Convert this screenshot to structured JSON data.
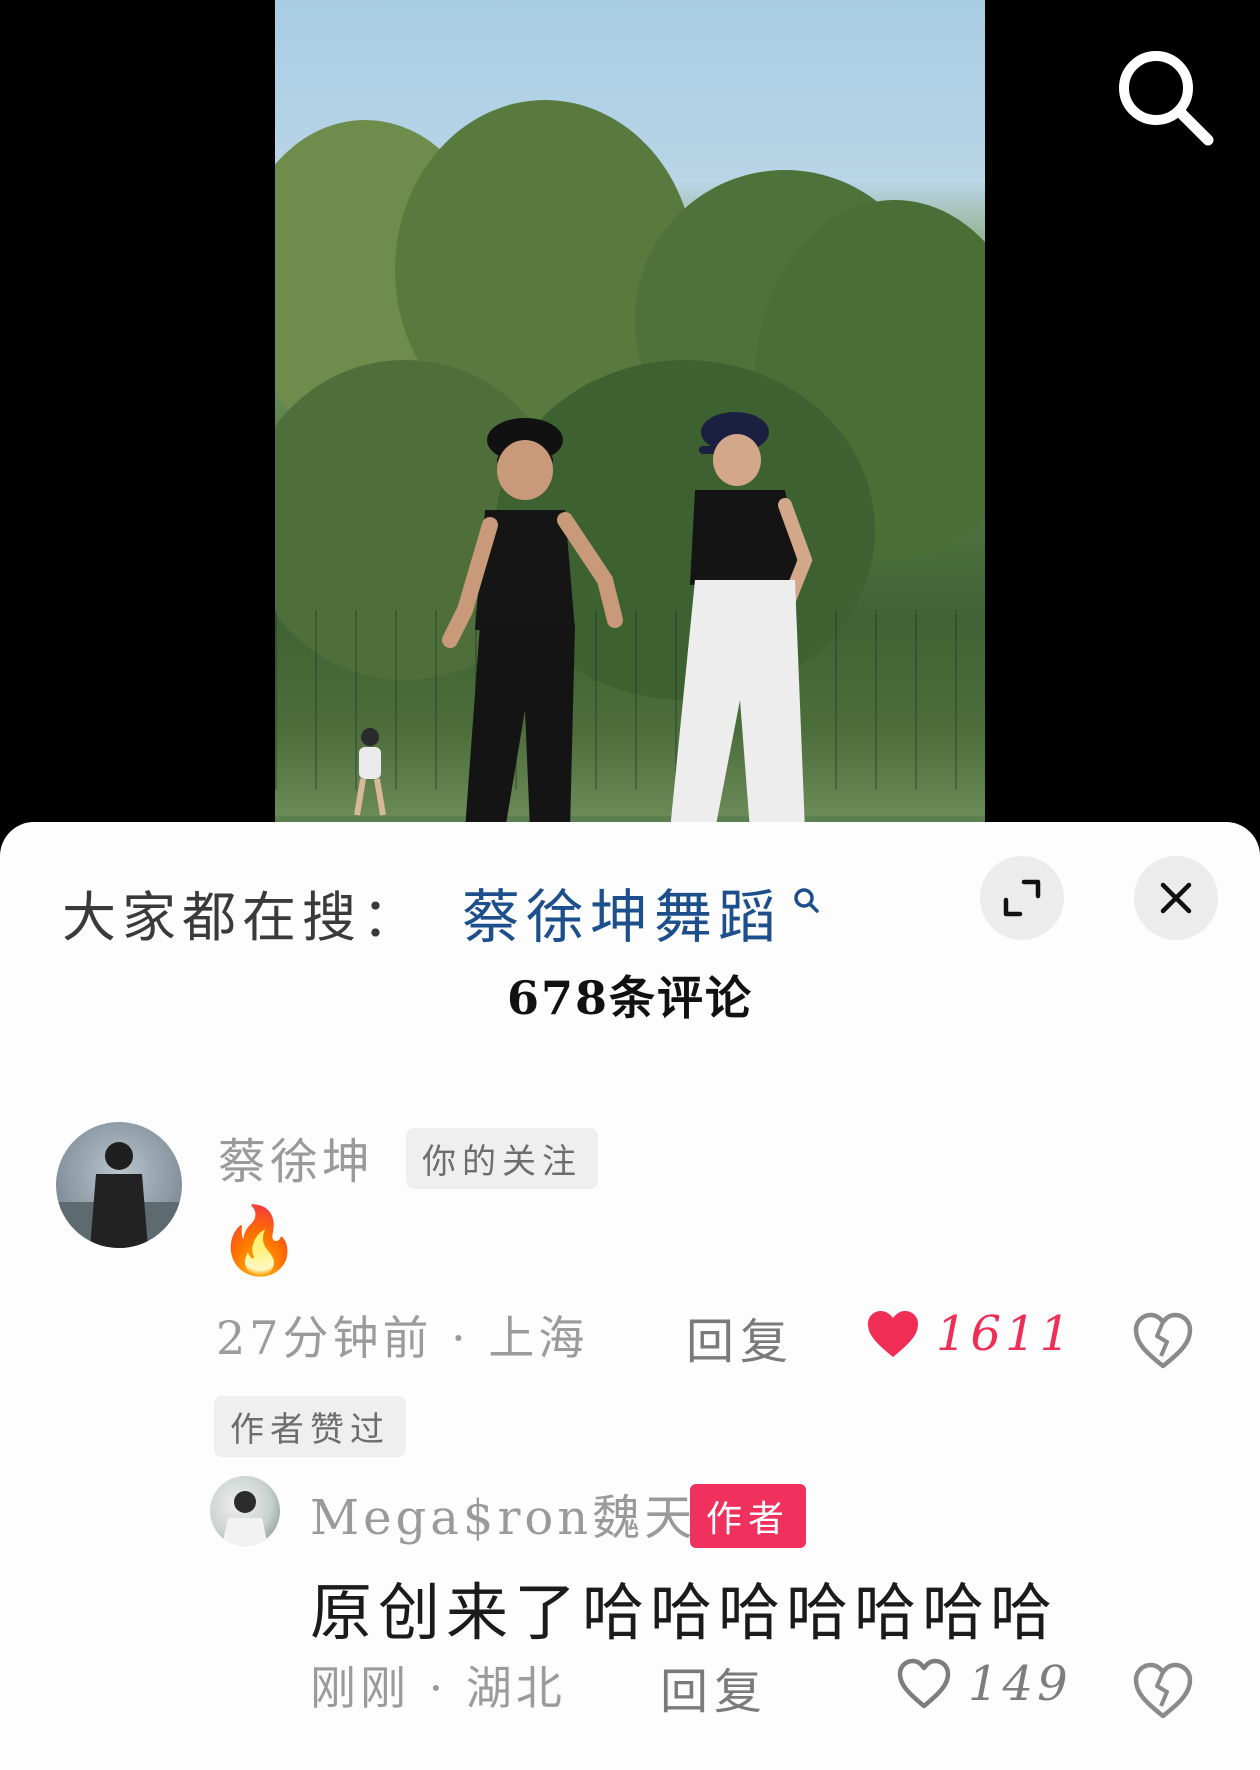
{
  "video": {
    "search_icon": "search-icon"
  },
  "sheet": {
    "hot_search_label": "大家都在搜：",
    "hot_search_term": "蔡徐坤舞蹈",
    "comment_count_label": "678条评论",
    "expand_icon": "expand-icon",
    "close_icon": "close-icon"
  },
  "comments": [
    {
      "username": "蔡徐坤",
      "badge": "你的关注",
      "text": "🔥",
      "meta": "27分钟前 · 上海",
      "reply_label": "回复",
      "like_count": "1611",
      "liked": true,
      "author_liked_tag": "作者赞过"
    },
    {
      "username": "Mega$ron魏天",
      "badge": "作者",
      "text": "原创来了哈哈哈哈哈哈哈",
      "meta": "刚刚 · 湖北",
      "reply_label": "回复",
      "like_count": "149",
      "liked": false
    }
  ],
  "colors": {
    "accent_red": "#f0305d",
    "link_blue": "#1d4f8c",
    "like_red": "#ef2d55"
  }
}
